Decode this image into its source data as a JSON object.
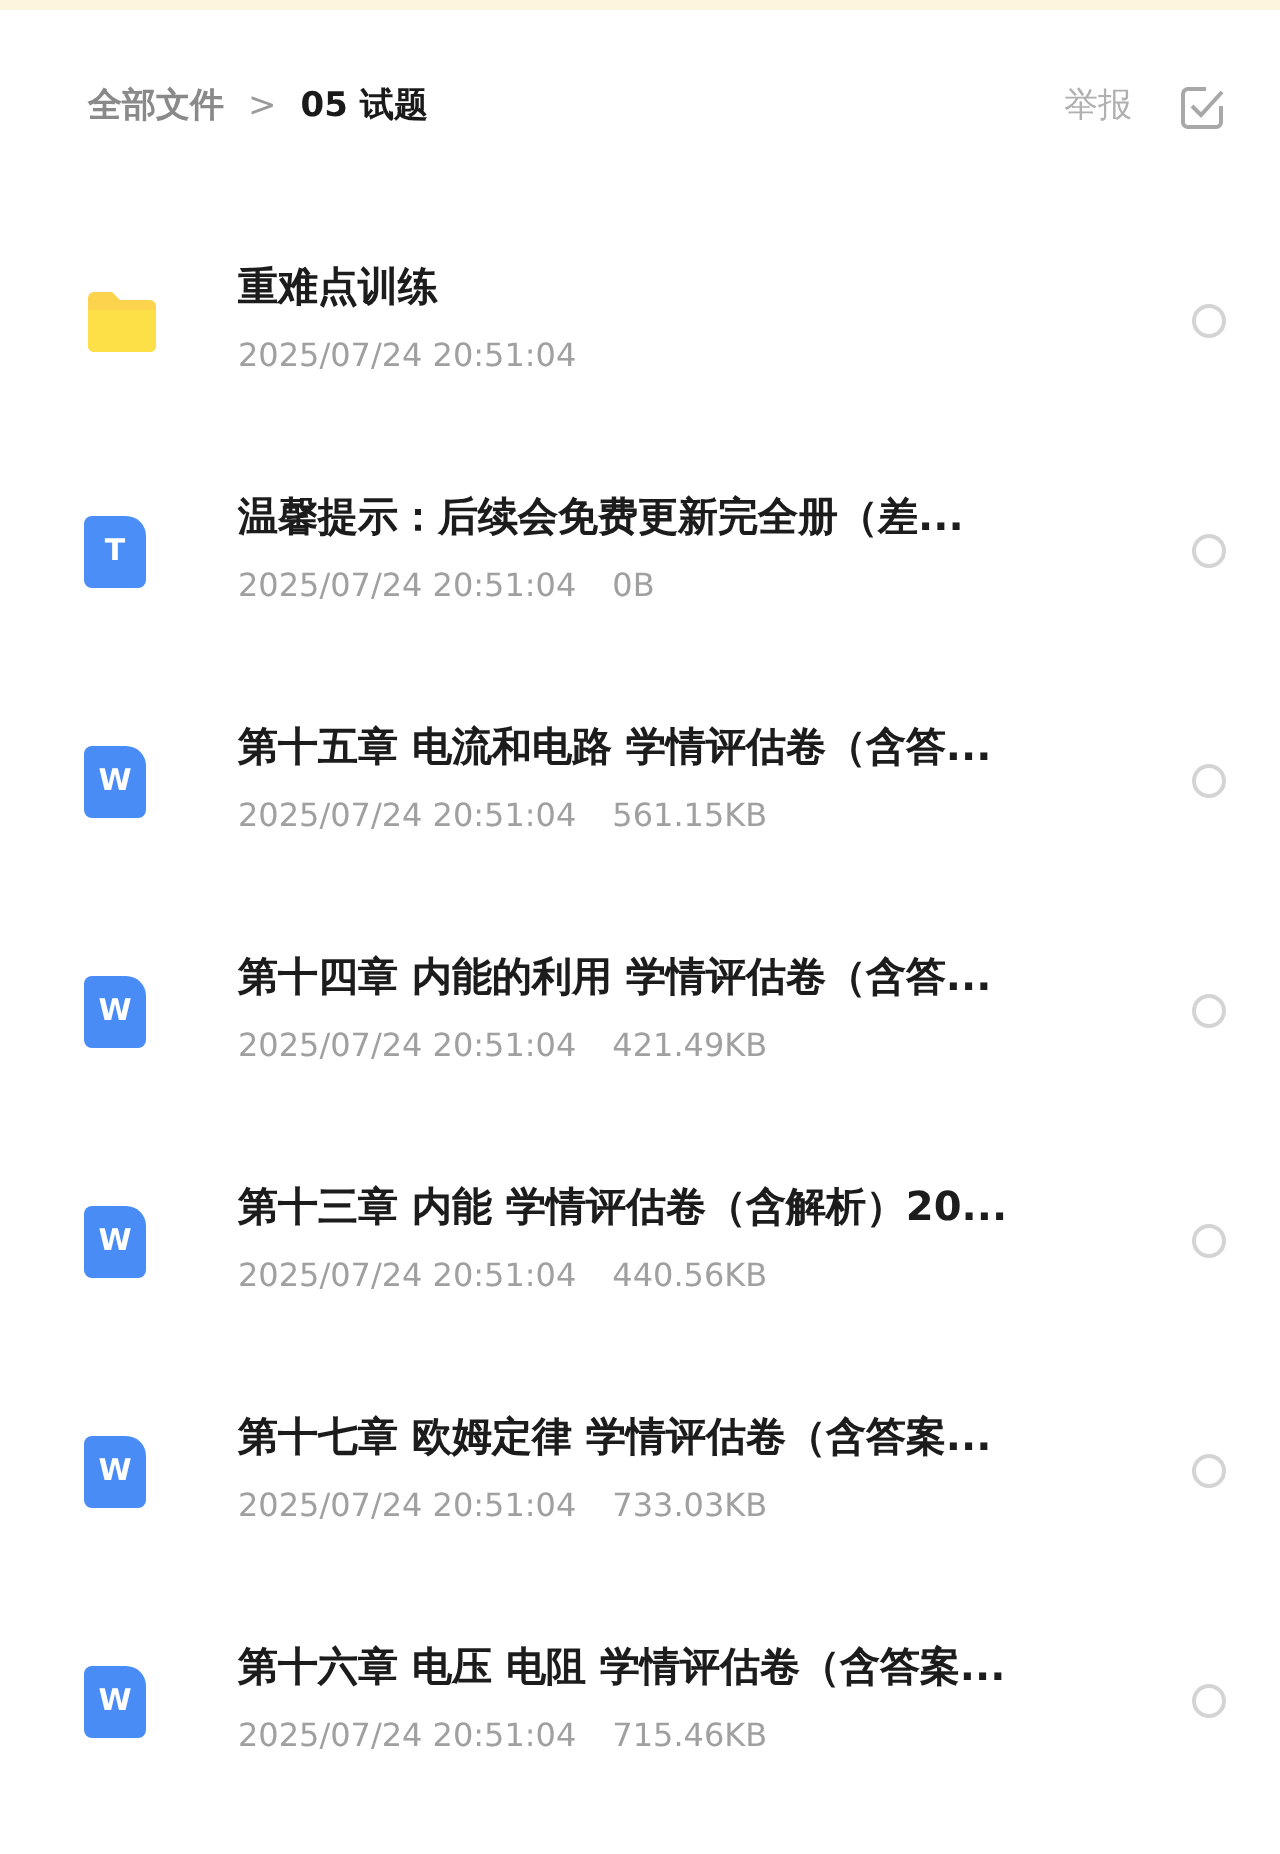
{
  "breadcrumb": [
    {
      "label": "全部文件",
      "current": false
    },
    {
      "label": "05 试题",
      "current": true
    }
  ],
  "breadcrumb_separator": ">",
  "report_label": "举报",
  "files": [
    {
      "kind": "folder",
      "name": "重难点训练",
      "date": "2025/07/24 20:51:04",
      "selected": false
    },
    {
      "kind": "txt",
      "icon_letter": "T",
      "name": "温馨提示：后续会免费更新完全册（差...",
      "date": "2025/07/24 20:51:04",
      "size": "0B",
      "selected": false
    },
    {
      "kind": "doc",
      "icon_letter": "W",
      "name": "第十五章 电流和电路 学情评估卷（含答...",
      "date": "2025/07/24 20:51:04",
      "size": "561.15KB",
      "selected": false
    },
    {
      "kind": "doc",
      "icon_letter": "W",
      "name": "第十四章 内能的利用 学情评估卷（含答...",
      "date": "2025/07/24 20:51:04",
      "size": "421.49KB",
      "selected": false
    },
    {
      "kind": "doc",
      "icon_letter": "W",
      "name": "第十三章 内能 学情评估卷（含解析）20...",
      "date": "2025/07/24 20:51:04",
      "size": "440.56KB",
      "selected": false
    },
    {
      "kind": "doc",
      "icon_letter": "W",
      "name": "第十七章 欧姆定律 学情评估卷（含答案...",
      "date": "2025/07/24 20:51:04",
      "size": "733.03KB",
      "selected": false
    },
    {
      "kind": "doc",
      "icon_letter": "W",
      "name": "第十六章 电压 电阻 学情评估卷（含答案...",
      "date": "2025/07/24 20:51:04",
      "size": "715.46KB",
      "selected": false
    }
  ]
}
